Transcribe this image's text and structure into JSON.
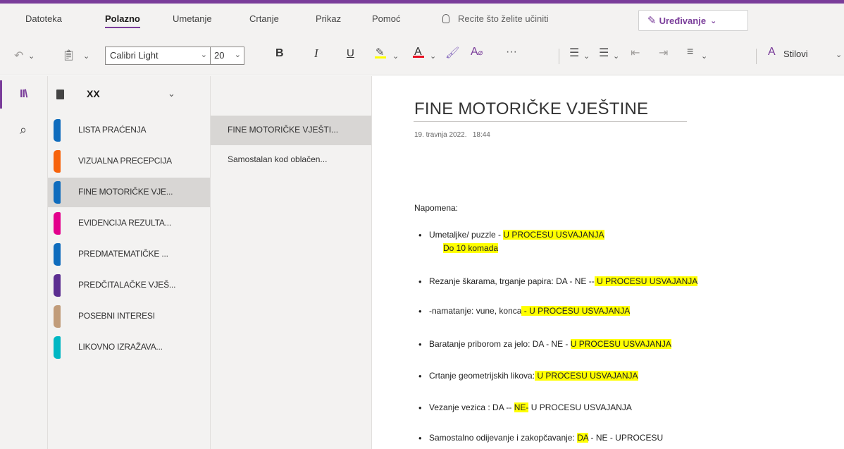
{
  "menu": {
    "tabs": [
      "Datoteka",
      "Polazno",
      "Umetanje",
      "Crtanje",
      "Prikaz",
      "Pomoć"
    ],
    "active_tab": "Polazno",
    "tell_me": "Recite što želite učiniti",
    "editing_label": "Uređivanje"
  },
  "toolbar": {
    "font_name": "Calibri Light",
    "font_size": "20",
    "bold": "B",
    "italic": "I",
    "underline": "U",
    "more": "···",
    "styles_label": "Stilovi"
  },
  "notebook": {
    "name": "XX"
  },
  "sections": [
    {
      "label": "LISTA PRAĆENJA",
      "color": "#0f6cbd"
    },
    {
      "label": "VIZUALNA PRECEPCIJA",
      "color": "#f7630c"
    },
    {
      "label": "FINE MOTORIČKE VJE...",
      "color": "#0f6cbd"
    },
    {
      "label": "EVIDENCIJA REZULTA...",
      "color": "#e3008c"
    },
    {
      "label": "PREDMATEMATIČKE ...",
      "color": "#0f6cbd"
    },
    {
      "label": "PREDČITALAČKE VJEŠ...",
      "color": "#5c2e91"
    },
    {
      "label": "POSEBNI INTERESI",
      "color": "#c19c7a"
    },
    {
      "label": "LIKOVNO IZRAŽAVA...",
      "color": "#00b7c3"
    }
  ],
  "active_section": 2,
  "pages": [
    {
      "label": "FINE MOTORIČKE VJEŠTI..."
    },
    {
      "label": "Samostalan kod oblačen..."
    }
  ],
  "active_page": 0,
  "page": {
    "title": "FINE MOTORIČKE VJEŠTINE",
    "date": "19. travnja 2022.",
    "time": "18:44",
    "note_label": "Napomena:",
    "items": [
      {
        "text": "Umetaljke/ puzzle - ",
        "hl": "U PROCESU USVAJANJA",
        "cont": "Do 10 komada"
      },
      {
        "text": "Rezanje škarama, trganje papira: DA  -  NE --",
        "hl": " U PROCESU USVAJANJA"
      },
      {
        "text": "-namatanje: vune, konca",
        "hl": " - U PROCESU USVAJANJA"
      },
      {
        "text": "Baratanje priborom za jelo:  DA  -  NE  -  ",
        "hl": "U PROCESU USVAJANJA"
      },
      {
        "text": "Crtanje geometrijskih likova:",
        "hl": " U PROCESU USVAJANJA"
      },
      {
        "text_a": "Vezanje vezica : DA -- ",
        "hl": "NE-",
        "text_b": "  U PROCESU USVAJANJA"
      },
      {
        "text_a": "Samostalno odijevanje i  zakopčavanje: ",
        "hl": "DA",
        "text_b": " - NE - UPROCESU"
      }
    ]
  }
}
